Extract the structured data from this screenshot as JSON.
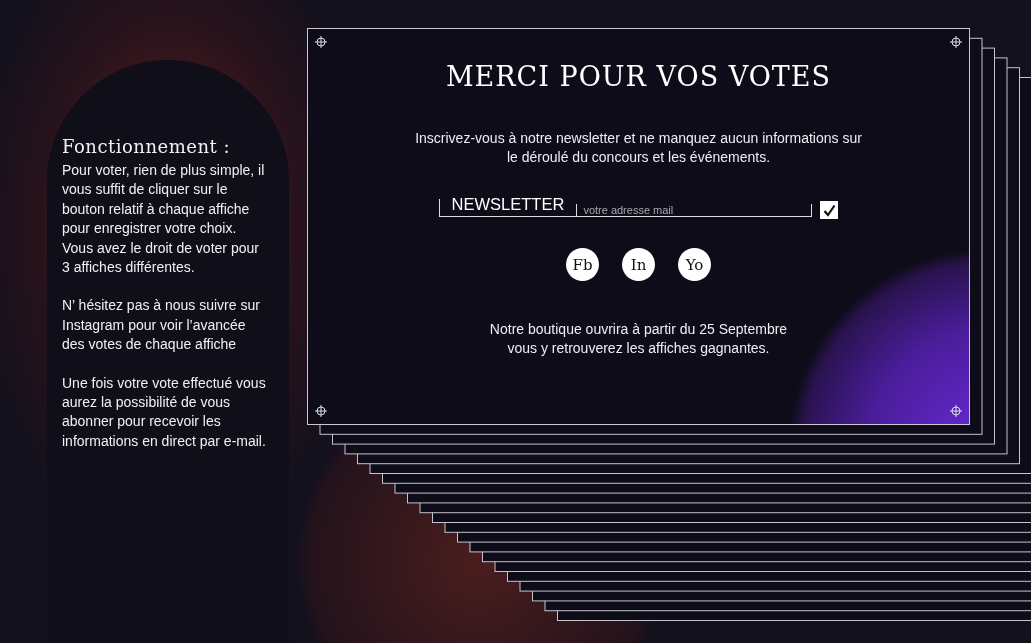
{
  "sidebar": {
    "title": "Fonctionnement :",
    "paragraphs": [
      "Pour voter, rien de plus simple, il vous suffit de cliquer sur le bouton relatif à chaque affiche pour enregistrer votre choix. Vous avez le droit de voter pour 3 affiches différentes.",
      "N’ hésitez pas à nous suivre sur Instagram pour voir l’avancée des votes de chaque affiche",
      "Une fois votre vote effectué vous aurez la possibilité de vous abonner pour recevoir les informations en direct par e-mail."
    ]
  },
  "card": {
    "title": "MERCI POUR VOS VOTES",
    "intro": "Inscrivez-vous à notre newsletter et ne manquez aucun informations sur\nle déroulé du concours et les événements.",
    "newsletter": {
      "label": "NEWSLETTER",
      "placeholder": "votre adresse mail",
      "checked": true
    },
    "socials": [
      {
        "label": "Fb"
      },
      {
        "label": "In"
      },
      {
        "label": "Yo"
      }
    ],
    "footer": "Notre boutique ouvrira à partir du 25 Septembre\nvous y retrouverez les affiches gagnantes."
  }
}
